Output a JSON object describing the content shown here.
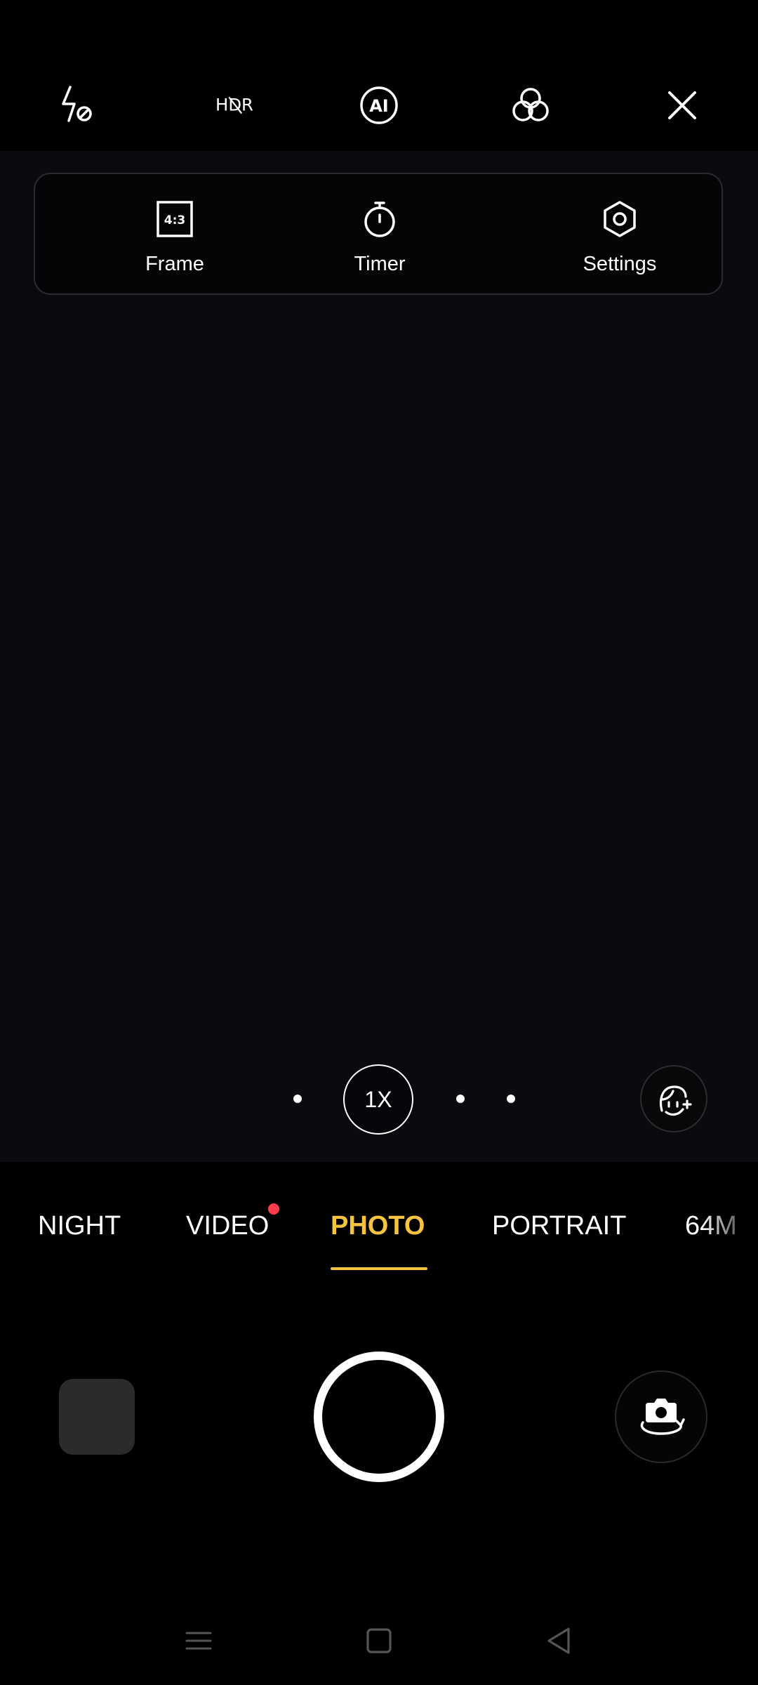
{
  "top_toolbar": {
    "flash": {
      "icon": "flash-off-icon"
    },
    "hdr": {
      "label": "HDR",
      "icon": "hdr-off-icon"
    },
    "ai": {
      "label": "AI",
      "icon": "ai-scene-icon"
    },
    "filters": {
      "icon": "filters-icon"
    },
    "close": {
      "icon": "close-icon"
    }
  },
  "quick_panel": {
    "items": [
      {
        "label": "Frame",
        "icon": "aspect-ratio-icon",
        "badge": "4:3"
      },
      {
        "label": "Timer",
        "icon": "timer-icon"
      },
      {
        "label": "Settings",
        "icon": "settings-icon"
      }
    ]
  },
  "zoom": {
    "current": "1X"
  },
  "modes": {
    "items": [
      "NIGHT",
      "VIDEO",
      "PHOTO",
      "PORTRAIT",
      "64M"
    ],
    "active": "PHOTO",
    "new_badge_on": "VIDEO"
  },
  "colors": {
    "accent": "#f5c242",
    "badge": "#ff3b4e",
    "background": "#000000",
    "viewfinder": "#0a0a0f"
  },
  "controls": {
    "gallery": "gallery-thumbnail",
    "shutter": "shutter-button",
    "switch_camera": "switch-camera-icon",
    "beauty": "beauty-face-icon"
  },
  "nav": {
    "recents": "recents-icon",
    "home": "home-icon",
    "back": "back-icon"
  }
}
